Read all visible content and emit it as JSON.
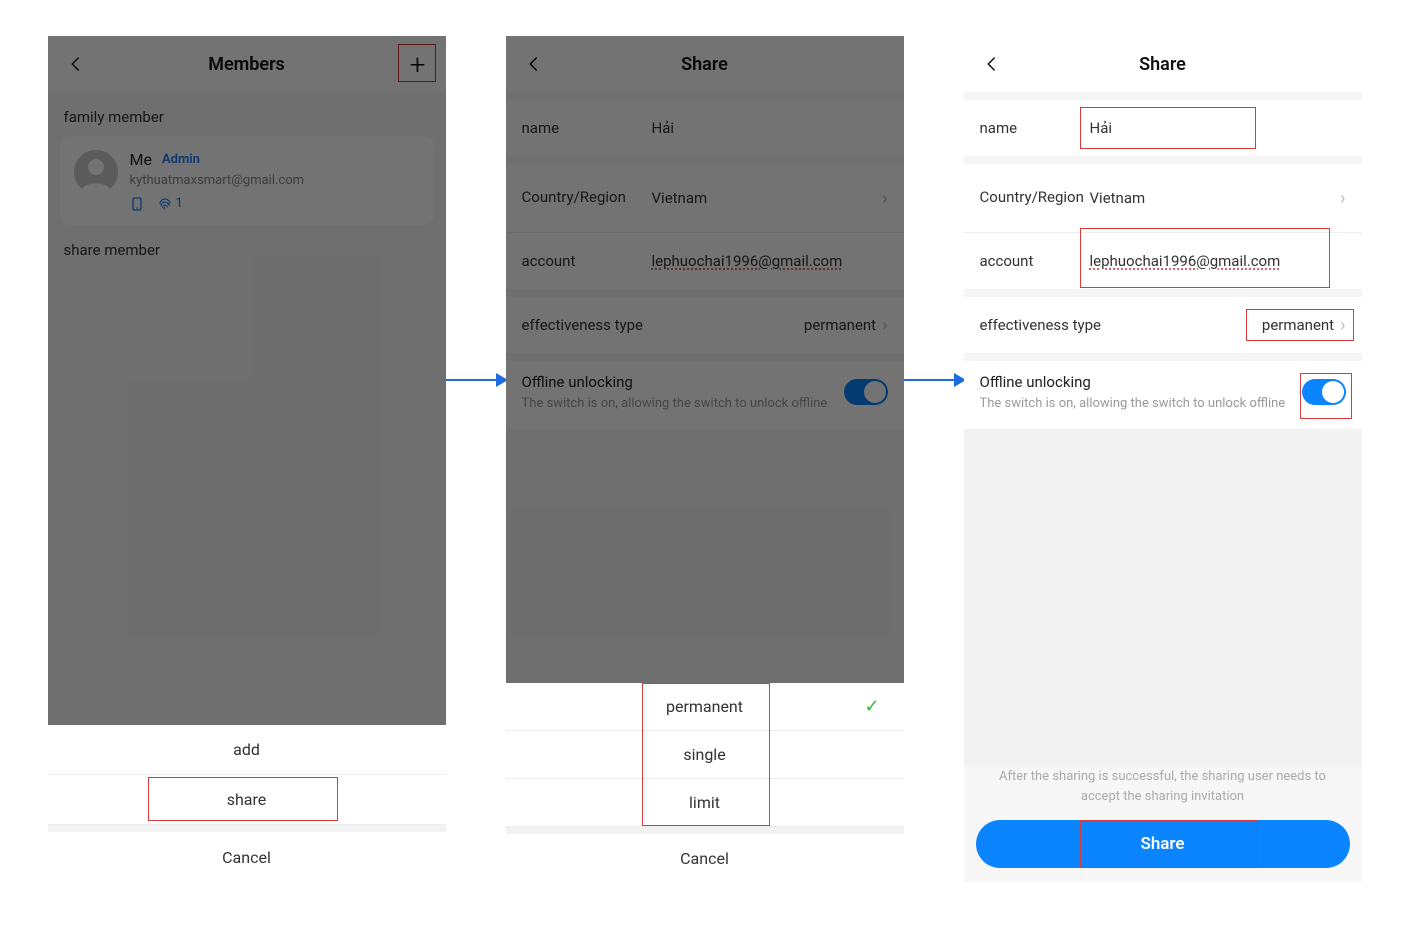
{
  "screen1": {
    "title": "Members",
    "family_label": "family member",
    "share_label": "share member",
    "me_name": "Me",
    "admin_badge": "Admin",
    "me_email": "kythuatmaxsmart@gmail.com",
    "fingerprint_count": "1",
    "sheet": {
      "add": "add",
      "share": "share",
      "cancel": "Cancel"
    }
  },
  "screen2": {
    "title": "Share",
    "labels": {
      "name": "name",
      "country": "Country/Region",
      "account": "account",
      "effectiveness": "effectiveness type"
    },
    "values": {
      "name": "Hải",
      "country": "Vietnam",
      "account": "lephuochai1996@gmail.com",
      "effectiveness": "permanent"
    },
    "offline": {
      "title": "Offline unlocking",
      "sub": "The switch is on, allowing the switch to unlock offline"
    },
    "picker": {
      "permanent": "permanent",
      "single": "single",
      "limit": "limit",
      "cancel": "Cancel"
    }
  },
  "screen3": {
    "title": "Share",
    "labels": {
      "name": "name",
      "country": "Country/Region",
      "account": "account",
      "effectiveness": "effectiveness type"
    },
    "values": {
      "name": "Hải",
      "country": "Vietnam",
      "account": "lephuochai1996@gmail.com",
      "effectiveness": "permanent"
    },
    "offline": {
      "title": "Offline unlocking",
      "sub": "The switch is on, allowing the switch to unlock offline"
    },
    "notice": "After the sharing is successful, the sharing user needs to accept the sharing invitation",
    "share_btn": "Share"
  }
}
